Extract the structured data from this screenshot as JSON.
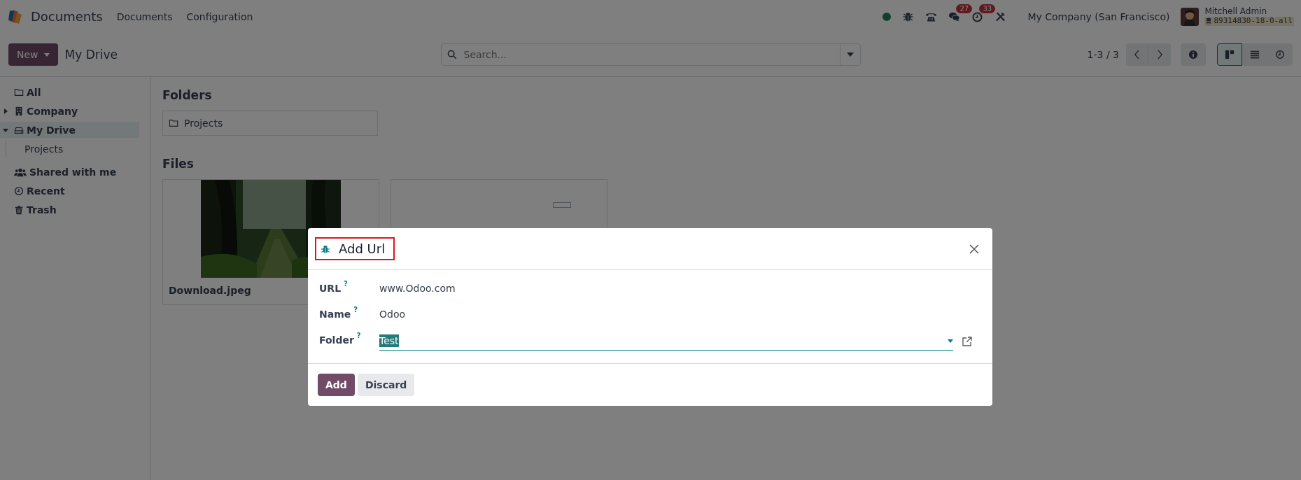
{
  "app": {
    "name": "Documents",
    "menus": [
      "Documents",
      "Configuration"
    ]
  },
  "systray": {
    "messages_count": "27",
    "activities_count": "33",
    "company": "My Company (San Francisco)",
    "user": "Mitchell Admin",
    "database": "89314830-18-0-all"
  },
  "control_panel": {
    "new_button": "New",
    "breadcrumb": "My Drive",
    "search": {
      "placeholder": "Search..."
    },
    "pager": "1-3 / 3",
    "views": [
      {
        "kind": "kanban",
        "selected": true
      },
      {
        "kind": "list",
        "selected": false
      },
      {
        "kind": "activity",
        "selected": false
      }
    ]
  },
  "sidebar": {
    "groups": [
      {
        "items": [
          {
            "label": "All",
            "kind": "folder",
            "selected": false
          },
          {
            "label": "Company",
            "kind": "building",
            "selected": false,
            "expanded": false
          },
          {
            "label": "My Drive",
            "kind": "drive",
            "selected": true,
            "expanded": true,
            "children": [
              {
                "label": "Projects",
                "selected": false
              }
            ]
          }
        ]
      },
      {
        "items": [
          {
            "label": "Shared with me",
            "kind": "users",
            "selected": false
          },
          {
            "label": "Recent",
            "kind": "clock",
            "selected": false
          },
          {
            "label": "Trash",
            "kind": "trash",
            "selected": false
          }
        ]
      }
    ]
  },
  "folders": {
    "title": "Folders",
    "items": [
      {
        "name": "Projects"
      }
    ]
  },
  "files": {
    "title": "Files",
    "items": [
      {
        "kind": "picture",
        "name": "Download.jpeg"
      },
      {
        "kind": "document"
      }
    ]
  },
  "dialog": {
    "title": "Add Url",
    "fields": [
      {
        "label": "URL",
        "help": "?",
        "value": "www.Odoo.com",
        "kind": "text"
      },
      {
        "label": "Name",
        "help": "?",
        "value": "Odoo",
        "kind": "text"
      },
      {
        "label": "Folder",
        "help": "?",
        "value": "Test",
        "kind": "many2one",
        "highlighted": true
      }
    ],
    "buttons": [
      {
        "label": "Add",
        "primary": true
      },
      {
        "label": "Discard",
        "primary": false
      }
    ]
  }
}
